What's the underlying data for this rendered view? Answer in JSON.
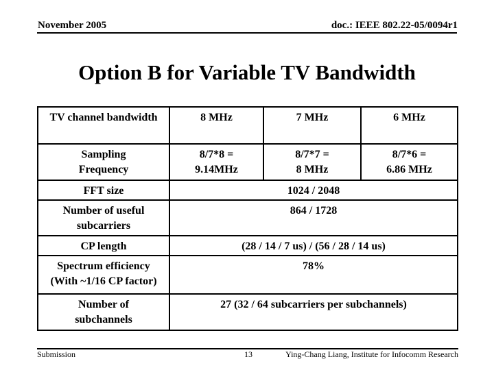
{
  "header": {
    "date": "November 2005",
    "doc_id": "doc.: IEEE 802.22-05/0094r1"
  },
  "title": "Option B for Variable TV Bandwidth",
  "table": {
    "rows": [
      {
        "label": "TV channel bandwidth",
        "values": [
          "8 MHz",
          "7 MHz",
          "6 MHz"
        ]
      },
      {
        "label_lines": [
          "Sampling",
          "Frequency"
        ],
        "values": [
          [
            "8/7*8 =",
            "9.14MHz"
          ],
          [
            "8/7*7 =",
            "8 MHz"
          ],
          [
            "8/7*6 =",
            "6.86 MHz"
          ]
        ]
      },
      {
        "label": "FFT size",
        "value": "1024 / 2048"
      },
      {
        "label_lines": [
          "Number of useful",
          "subcarriers"
        ],
        "value": "864 / 1728"
      },
      {
        "label": "CP length",
        "value": "(28 / 14 / 7 us) / (56 / 28 / 14 us)"
      },
      {
        "label_lines": [
          "Spectrum efficiency",
          "(With ~1/16 CP factor)"
        ],
        "value": "78%"
      },
      {
        "label_lines": [
          "Number of",
          "subchannels"
        ],
        "value": "27 (32 / 64 subcarriers per subchannels)"
      }
    ]
  },
  "footer": {
    "left": "Submission",
    "page": "13",
    "right": "Ying-Chang Liang, Institute for Infocomm Research"
  }
}
